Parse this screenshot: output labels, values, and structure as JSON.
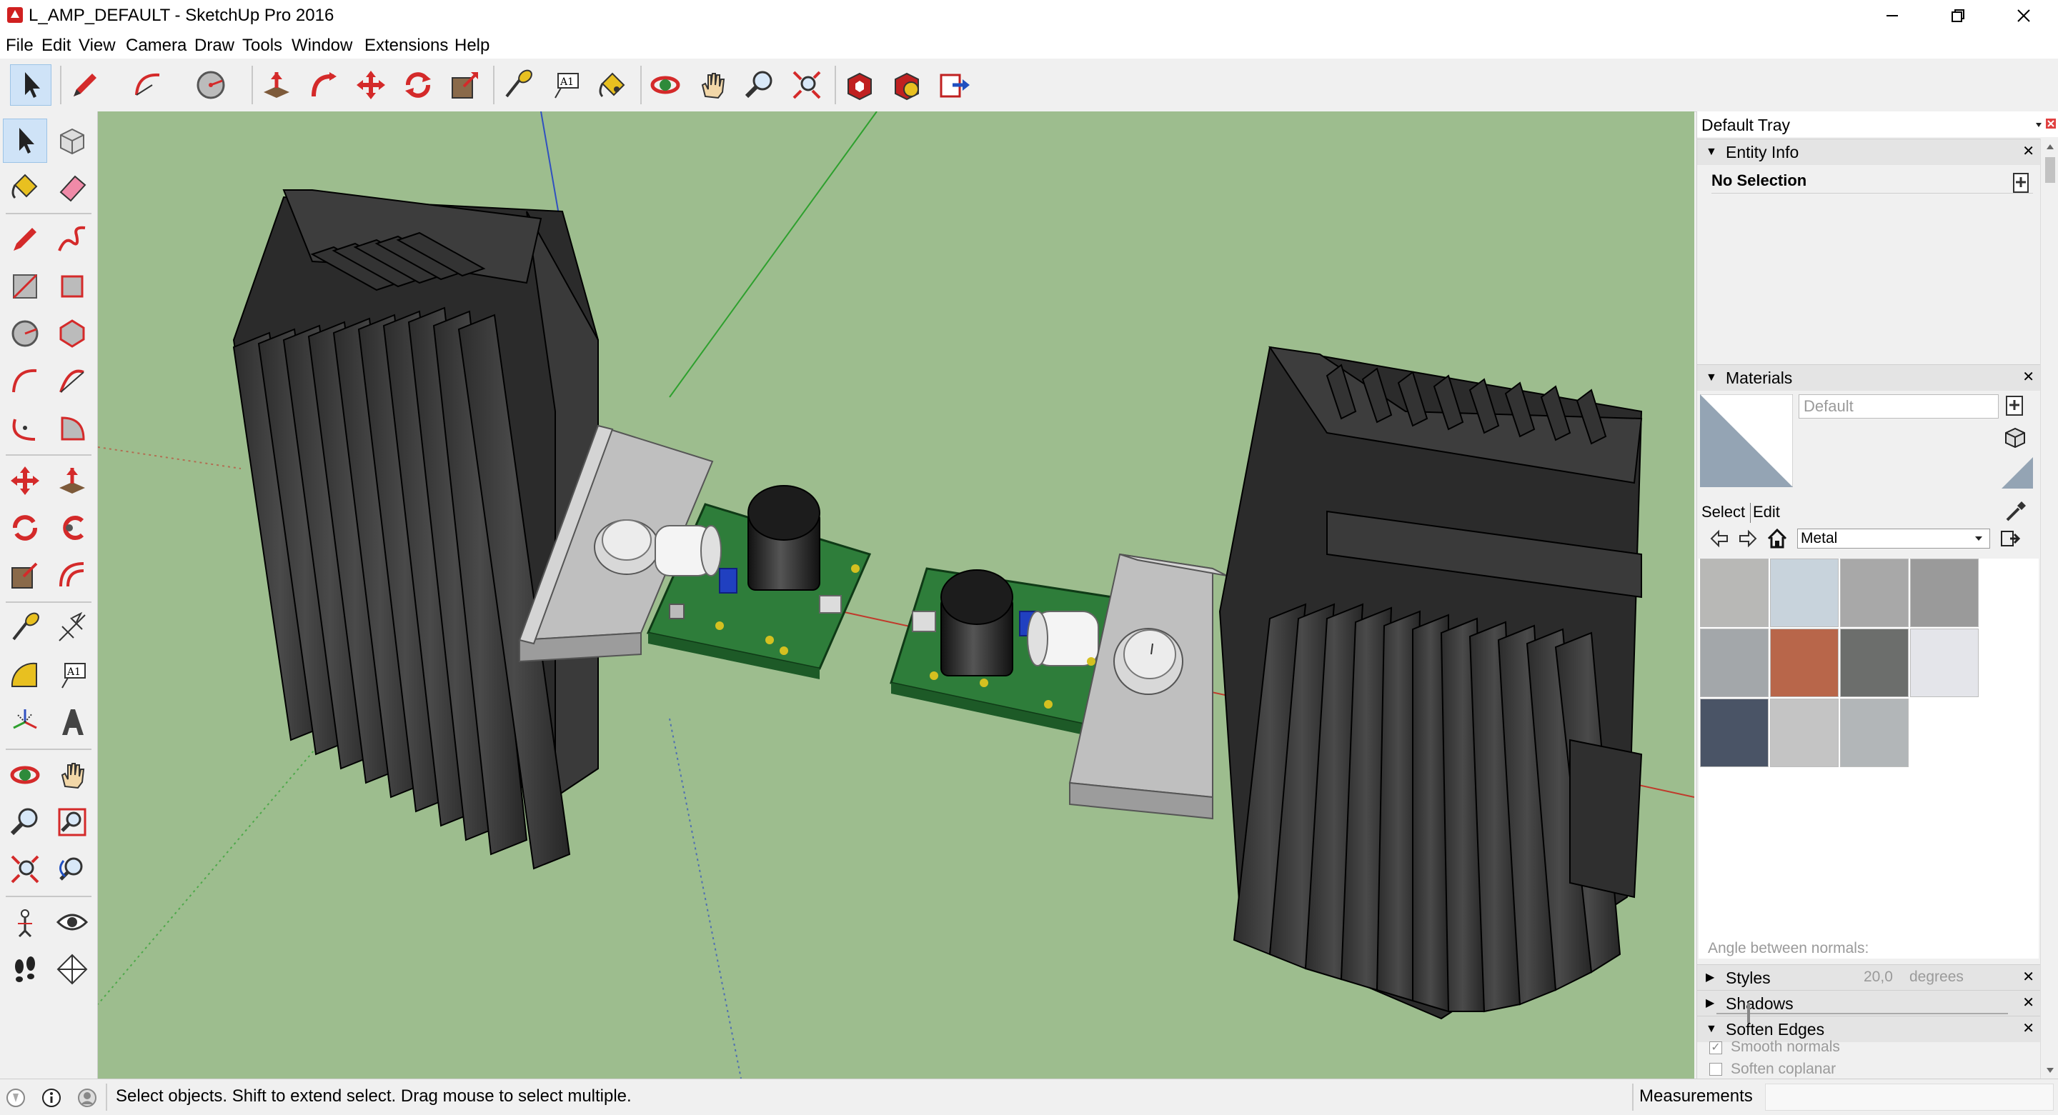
{
  "window": {
    "title": "L_AMP_DEFAULT - SketchUp Pro 2016",
    "minimize_icon": "minimize-icon",
    "restore_icon": "restore-icon",
    "close_icon": "close-icon"
  },
  "menu": {
    "items": [
      "File",
      "Edit",
      "View",
      "Camera",
      "Draw",
      "Tools",
      "Window",
      "Extensions",
      "Help"
    ]
  },
  "toolbar": {
    "icons": [
      "select-icon",
      "pencil-icon",
      "arc-icon",
      "circle-icon",
      "push-pull-icon",
      "follow-me-icon",
      "move-icon",
      "rotate-icon",
      "scale-icon",
      "tape-measure-icon",
      "text-icon",
      "paint-bucket-icon",
      "orbit-icon",
      "pan-icon",
      "zoom-icon",
      "zoom-extents-icon",
      "warehouse-icon",
      "extension-warehouse-icon",
      "send-to-layout-icon"
    ]
  },
  "left_toolbar": {
    "icons": [
      "select-icon",
      "make-component-icon",
      "paint-bucket-icon",
      "eraser-icon",
      "line-icon",
      "freehand-icon",
      "rectangle-icon",
      "rotated-rectangle-icon",
      "circle-icon",
      "polygon-icon",
      "arc-icon",
      "two-point-arc-icon",
      "three-point-arc-icon",
      "pie-icon",
      "move-icon",
      "push-pull-icon",
      "rotate-icon",
      "follow-me-icon",
      "scale-icon",
      "offset-icon",
      "tape-measure-icon",
      "dimension-icon",
      "protractor-icon",
      "text-icon",
      "axes-icon",
      "3d-text-icon",
      "orbit-icon",
      "pan-icon",
      "zoom-icon",
      "zoom-window-icon",
      "zoom-extents-icon",
      "previous-view-icon",
      "position-camera-icon",
      "look-around-icon",
      "walk-icon",
      "section-plane-icon"
    ],
    "text_tool_label": "A1"
  },
  "tray": {
    "title": "Default Tray",
    "entity_info": {
      "header": "Entity Info",
      "selection": "No Selection"
    },
    "materials": {
      "header": "Materials",
      "current_name": "Default",
      "tab_select": "Select",
      "tab_edit": "Edit",
      "library": "Metal",
      "swatches": [
        "#b8b8b6",
        "#c8d3dc",
        "#a8a8a8",
        "#9a9a9a",
        "#a3a7aa",
        "#b8664a",
        "#6c6e6c",
        "#e4e5ea",
        "#4a5466",
        "#c4c4c4",
        "#b2b6b8"
      ]
    },
    "styles_header": "Styles",
    "shadows_header": "Shadows",
    "soften_edges": {
      "header": "Soften Edges",
      "angle_label": "Angle between normals:",
      "angle_value": "20,0",
      "angle_unit": "degrees",
      "slider_fraction": 0.11,
      "smooth_normals_label": "Smooth normals",
      "smooth_normals_checked": true,
      "soften_coplanar_label": "Soften coplanar",
      "soften_coplanar_checked": false
    }
  },
  "status": {
    "text": "Select objects. Shift to extend select. Drag mouse to select multiple.",
    "measurements_label": "Measurements"
  },
  "colors": {
    "viewport_bg": "#9dbd8e",
    "heatsink": "#3a3a3a",
    "pcb": "#2e7d3a",
    "bracket": "#b8b8b8",
    "axis_red": "#c0392b",
    "axis_green": "#2ea02e",
    "axis_blue": "#3050c0"
  }
}
